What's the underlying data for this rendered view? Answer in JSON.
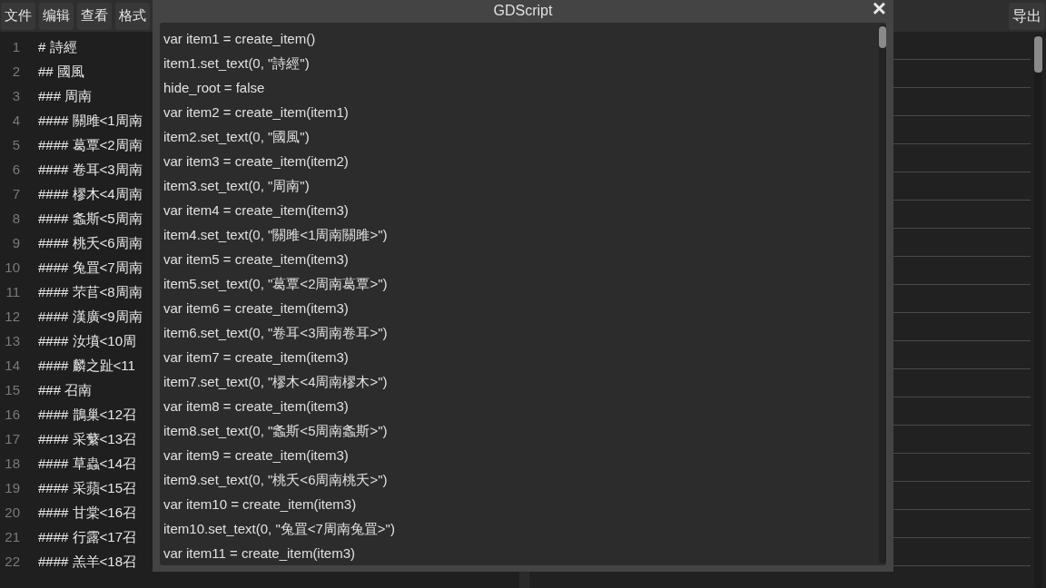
{
  "menu": [
    {
      "label": "文件"
    },
    {
      "label": "编辑"
    },
    {
      "label": "查看"
    },
    {
      "label": "格式"
    }
  ],
  "export_button": {
    "label": "导出"
  },
  "editor": {
    "lines": [
      {
        "number": "1",
        "text": "# 詩經"
      },
      {
        "number": "2",
        "text": "## 國風"
      },
      {
        "number": "3",
        "text": "### 周南"
      },
      {
        "number": "4",
        "text": "#### 關雎<1周南"
      },
      {
        "number": "5",
        "text": "#### 葛覃<2周南"
      },
      {
        "number": "6",
        "text": "#### 卷耳<3周南"
      },
      {
        "number": "7",
        "text": "#### 樛木<4周南"
      },
      {
        "number": "8",
        "text": "#### 螽斯<5周南"
      },
      {
        "number": "9",
        "text": "#### 桃夭<6周南"
      },
      {
        "number": "10",
        "text": "#### 兔罝<7周南"
      },
      {
        "number": "11",
        "text": "#### 芣苢<8周南"
      },
      {
        "number": "12",
        "text": "#### 漢廣<9周南"
      },
      {
        "number": "13",
        "text": "#### 汝墳<10周"
      },
      {
        "number": "14",
        "text": "#### 麟之趾<11"
      },
      {
        "number": "15",
        "text": "### 召南"
      },
      {
        "number": "16",
        "text": "#### 鵲巢<12召"
      },
      {
        "number": "17",
        "text": "#### 采蘩<13召"
      },
      {
        "number": "18",
        "text": "#### 草蟲<14召"
      },
      {
        "number": "19",
        "text": "#### 采蘋<15召"
      },
      {
        "number": "20",
        "text": "#### 甘棠<16召"
      },
      {
        "number": "21",
        "text": "#### 行露<17召"
      },
      {
        "number": "22",
        "text": "#### 羔羊<18召"
      }
    ]
  },
  "dialog": {
    "title": "GDScript",
    "close": "×",
    "lines": [
      "var item1 = create_item()",
      "item1.set_text(0, \"詩經\")",
      "hide_root = false",
      "var item2 = create_item(item1)",
      "item2.set_text(0, \"國風\")",
      "var item3 = create_item(item2)",
      "item3.set_text(0, \"周南\")",
      "var item4 = create_item(item3)",
      "item4.set_text(0, \"關雎<1周南關雎>\")",
      "var item5 = create_item(item3)",
      "item5.set_text(0, \"葛覃<2周南葛覃>\")",
      "var item6 = create_item(item3)",
      "item6.set_text(0, \"卷耳<3周南卷耳>\")",
      "var item7 = create_item(item3)",
      "item7.set_text(0, \"樛木<4周南樛木>\")",
      "var item8 = create_item(item3)",
      "item8.set_text(0, \"螽斯<5周南螽斯>\")",
      "var item9 = create_item(item3)",
      "item9.set_text(0, \"桃夭<6周南桃夭>\")",
      "var item10 = create_item(item3)",
      "item10.set_text(0, \"兔罝<7周南兔罝>\")",
      "var item11 = create_item(item3)"
    ]
  }
}
